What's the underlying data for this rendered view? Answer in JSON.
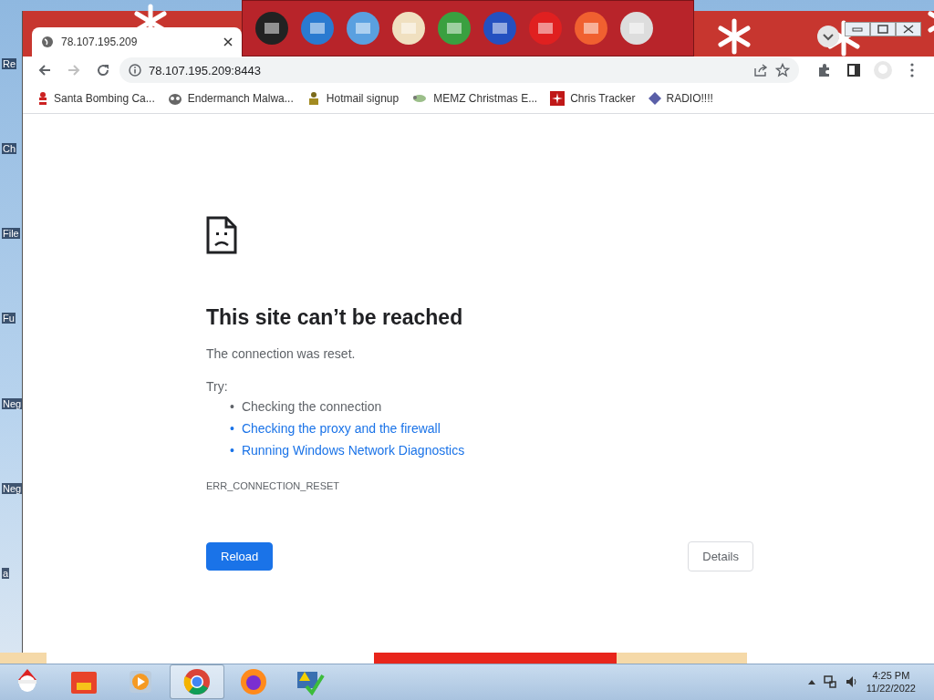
{
  "desktop": {
    "icons": [
      {
        "label": "Re"
      },
      {
        "label": "Ch"
      },
      {
        "label": "File"
      },
      {
        "label": "Fu"
      },
      {
        "label": "Neg"
      },
      {
        "label": "Neg"
      },
      {
        "label": "a"
      }
    ]
  },
  "window": {
    "tab": {
      "title": "78.107.195.209"
    },
    "address": "78.107.195.209:8443",
    "bookmarks": [
      {
        "label": "Santa Bombing Ca..."
      },
      {
        "label": "Endermanch Malwa..."
      },
      {
        "label": "Hotmail signup"
      },
      {
        "label": "MEMZ Christmas E..."
      },
      {
        "label": "Chris Tracker"
      },
      {
        "label": "RADIO!!!!"
      }
    ]
  },
  "error": {
    "title": "This site can’t be reached",
    "message": "The connection was reset.",
    "try_label": "Try:",
    "suggestions": [
      {
        "marker": "•",
        "text": "Checking the connection",
        "kind": "text"
      },
      {
        "marker": "•",
        "text": "Checking the proxy and the firewall",
        "kind": "link"
      },
      {
        "marker": "•",
        "text": "Running Windows Network Diagnostics",
        "kind": "link"
      }
    ],
    "code": "ERR_CONNECTION_RESET",
    "buttons": [
      {
        "label": "Reload",
        "kind": "primary"
      },
      {
        "label": "Details",
        "kind": "secondary"
      }
    ]
  },
  "taskbar": {
    "items": [
      {
        "selected": false
      },
      {
        "selected": false
      },
      {
        "selected": false
      },
      {
        "selected": true
      },
      {
        "selected": false
      },
      {
        "selected": false
      }
    ],
    "time": "4:25 PM",
    "date": "11/22/2022"
  }
}
